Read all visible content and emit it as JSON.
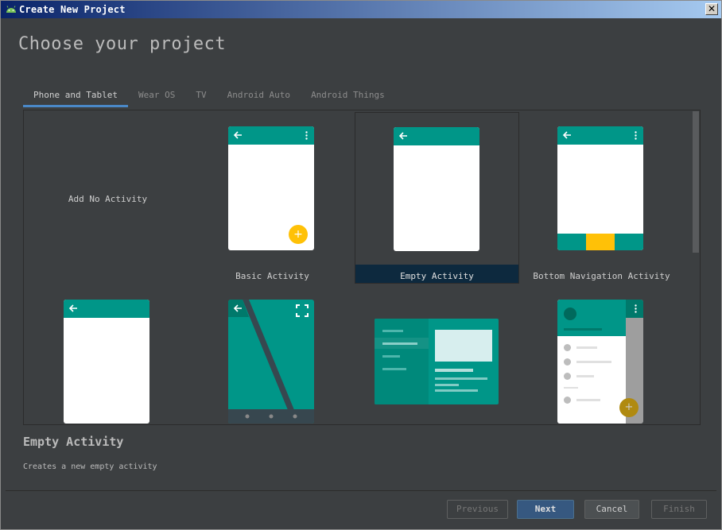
{
  "window": {
    "title": "Create New Project"
  },
  "header": {
    "title": "Choose your project"
  },
  "tabs": [
    {
      "label": "Phone and Tablet",
      "active": true
    },
    {
      "label": "Wear OS",
      "active": false
    },
    {
      "label": "TV",
      "active": false
    },
    {
      "label": "Android Auto",
      "active": false
    },
    {
      "label": "Android Things",
      "active": false
    }
  ],
  "templates": {
    "add_no_activity": "Add No Activity",
    "basic_activity": "Basic Activity",
    "empty_activity": "Empty Activity",
    "bottom_navigation_activity": "Bottom Navigation Activity"
  },
  "selected": {
    "title": "Empty Activity",
    "description": "Creates a new empty activity"
  },
  "buttons": {
    "previous": "Previous",
    "next": "Next",
    "cancel": "Cancel",
    "finish": "Finish"
  },
  "colors": {
    "accent": "#009688",
    "fab": "#ffc107",
    "selection": "#0d293e",
    "tab_underline": "#4a88c7"
  },
  "icons": {
    "app": "android-icon",
    "close": "close-icon",
    "back": "arrow-left-icon",
    "menu": "more-vert-icon",
    "fullscreen": "fullscreen-icon",
    "add": "plus-icon"
  }
}
